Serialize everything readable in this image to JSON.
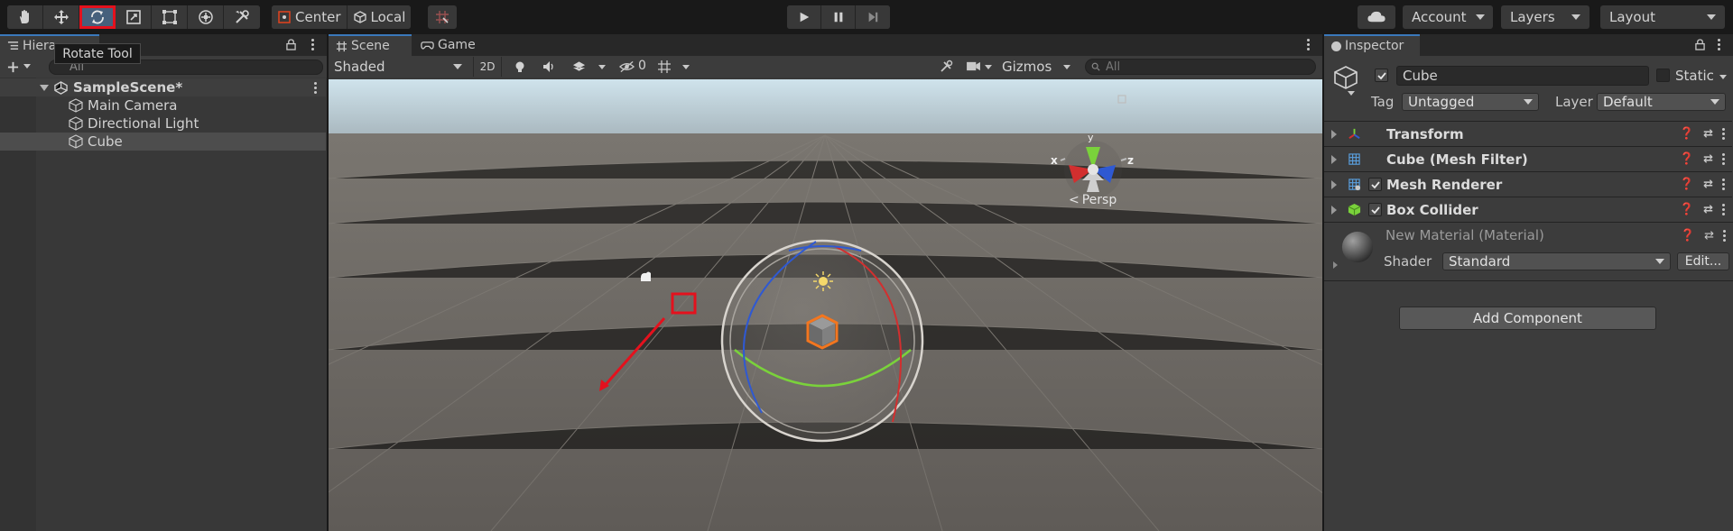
{
  "toolbar": {
    "tools": [
      {
        "name": "hand-tool",
        "icon": "hand-icon"
      },
      {
        "name": "move-tool",
        "icon": "move-icon"
      },
      {
        "name": "rotate-tool",
        "icon": "rotate-icon",
        "selected": true
      },
      {
        "name": "scale-tool",
        "icon": "scale-icon"
      },
      {
        "name": "rect-tool",
        "icon": "rect-icon"
      },
      {
        "name": "transform-tool",
        "icon": "transform-icon"
      },
      {
        "name": "custom-tool",
        "icon": "custom-tools-icon"
      }
    ],
    "pivot_label": "Center",
    "space_label": "Local",
    "tooltip": "Rotate Tool",
    "account_label": "Account",
    "layers_label": "Layers",
    "layout_label": "Layout"
  },
  "hierarchy": {
    "tab_label": "Hiera",
    "scene_name": "SampleScene*",
    "items": [
      "Main Camera",
      "Directional Light",
      "Cube"
    ],
    "search_value": "All"
  },
  "scene_view": {
    "tabs": [
      "Scene",
      "Game"
    ],
    "draw_mode": "Shaded",
    "toggle_2d": "2D",
    "hidden_count": "0",
    "gizmos_label": "Gizmos",
    "search_placeholder": "All",
    "gizmo_axes": {
      "x": "x",
      "y": "y",
      "z": "z"
    },
    "persp_label": "Persp"
  },
  "inspector": {
    "tab_label": "Inspector",
    "object_name": "Cube",
    "static_label": "Static",
    "tag_label": "Tag",
    "tag_value": "Untagged",
    "layer_label": "Layer",
    "layer_value": "Default",
    "components": [
      {
        "name": "Transform",
        "checkbox": false
      },
      {
        "name": "Cube (Mesh Filter)",
        "checkbox": false
      },
      {
        "name": "Mesh Renderer",
        "checkbox": true
      },
      {
        "name": "Box Collider",
        "checkbox": true
      }
    ],
    "material_name": "New Material (Material)",
    "shader_label": "Shader",
    "shader_value": "Standard",
    "edit_label": "Edit...",
    "add_component_label": "Add Component"
  },
  "colors": {
    "accent": "#3a79bb",
    "highlight_red": "#e4111d",
    "x_axis": "#d22f2f",
    "y_axis": "#7ad23b",
    "z_axis": "#2f59d2",
    "selection_orange": "#f3761f"
  }
}
